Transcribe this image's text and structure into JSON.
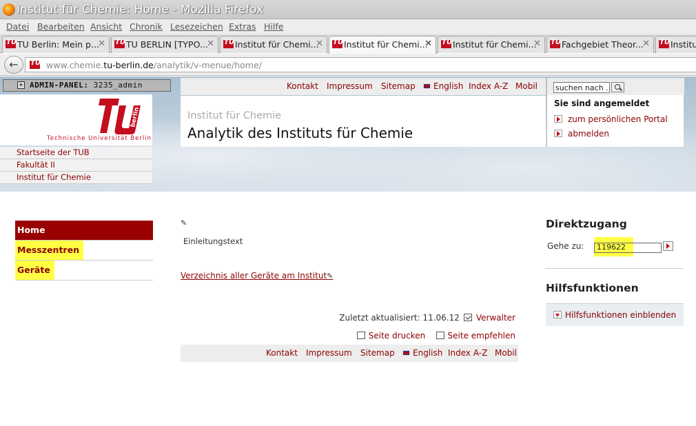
{
  "window": {
    "title": "Institut für Chemie: Home - Mozilla Firefox"
  },
  "menu": [
    "Datei",
    "Bearbeiten",
    "Ansicht",
    "Chronik",
    "Lesezeichen",
    "Extras",
    "Hilfe"
  ],
  "tabs": [
    {
      "label": "TU Berlin: Mein p..."
    },
    {
      "label": "TU BERLIN [TYPO..."
    },
    {
      "label": "Institut für Chemi..."
    },
    {
      "label": "Institut für Chemi..."
    },
    {
      "label": "Institut für Chemi..."
    },
    {
      "label": "Fachgebiet Theor..."
    },
    {
      "label": "Institu"
    }
  ],
  "address": {
    "prefix": "www.chemie.",
    "domain": "tu-berlin.de",
    "path": "/analytik/v-menue/home/"
  },
  "admin_panel": {
    "label": "ADMIN-PANEL:",
    "user": "3235_admin"
  },
  "logo": {
    "text": "berlin",
    "caption": "Technische Universität Berlin"
  },
  "breadcrumbs": [
    "Startseite der TUB",
    "Fakultät II",
    "Institut für Chemie"
  ],
  "topnav": {
    "kontakt": "Kontakt",
    "impressum": "Impressum",
    "sitemap": "Sitemap",
    "english": "English",
    "index": "Index A-Z",
    "mobil": "Mobil"
  },
  "header": {
    "subtitle": "Institut für Chemie",
    "title": "Analytik des Instituts für Chemie"
  },
  "login": {
    "search_placeholder": "suchen nach ...",
    "status": "Sie sind angemeldet",
    "portal": "zum persönlichen Portal",
    "logout": "abmelden"
  },
  "leftnav": [
    {
      "label": "Home"
    },
    {
      "label": "Messzentren"
    },
    {
      "label": "Geräte"
    }
  ],
  "content": {
    "pencil": "✎",
    "intro": "Einleitungstext",
    "directory_link": "Verzeichnis aller Geräte am Institut",
    "updated": "Zuletzt aktualisiert: 11.06.12",
    "admin": "Verwalter",
    "print": "Seite drucken",
    "recommend": "Seite empfehlen"
  },
  "direktzugang": {
    "title": "Direktzugang",
    "label": "Gehe zu:",
    "value": "119622"
  },
  "hilfsfunktionen": {
    "title": "Hilfsfunktionen",
    "link": "Hilfsfunktionen einblenden"
  },
  "colors": {
    "brand_red": "#c40d1e",
    "link": "#8b0000",
    "home_bg": "#990000",
    "highlight": "#ffff44"
  }
}
